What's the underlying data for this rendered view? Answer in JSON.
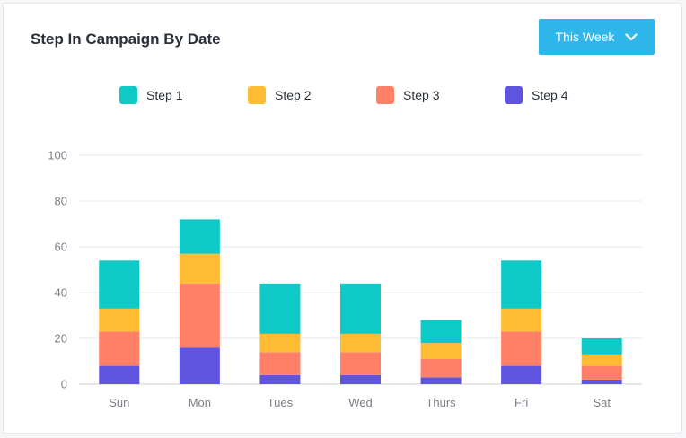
{
  "header": {
    "title": "Step In Campaign By Date",
    "filter_label": "This Week"
  },
  "colors": {
    "Step 1": "#0fc9c6",
    "Step 2": "#ffbb33",
    "Step 3": "#ff8066",
    "Step 4": "#5e54e0",
    "button": "#2fb6ea"
  },
  "chart_data": {
    "type": "bar",
    "stacked": true,
    "title": "Step In Campaign By Date",
    "xlabel": "",
    "ylabel": "",
    "ylim": [
      0,
      100
    ],
    "yticks": [
      0,
      20,
      40,
      60,
      80,
      100
    ],
    "grid": true,
    "legend_position": "top",
    "categories": [
      "Sun",
      "Mon",
      "Tues",
      "Wed",
      "Thurs",
      "Fri",
      "Sat"
    ],
    "series": [
      {
        "name": "Step 4",
        "values": [
          8,
          16,
          4,
          4,
          3,
          8,
          2
        ]
      },
      {
        "name": "Step 3",
        "values": [
          15,
          28,
          10,
          10,
          8,
          15,
          6
        ]
      },
      {
        "name": "Step 2",
        "values": [
          10,
          13,
          8,
          8,
          7,
          10,
          5
        ]
      },
      {
        "name": "Step 1",
        "values": [
          21,
          15,
          22,
          22,
          10,
          21,
          7
        ]
      }
    ],
    "legend": [
      "Step 1",
      "Step 2",
      "Step 3",
      "Step 4"
    ]
  }
}
